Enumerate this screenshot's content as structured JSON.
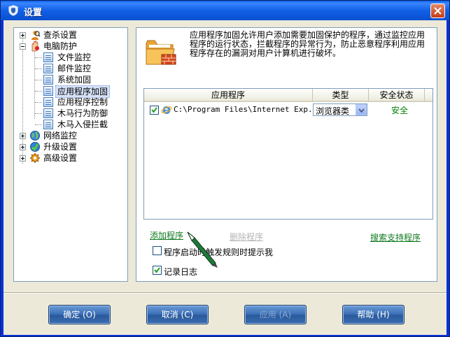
{
  "window": {
    "title": "设置"
  },
  "tree": {
    "items": [
      {
        "label": "查杀设置",
        "icon": "magnifier-user-icon",
        "expanded": false
      },
      {
        "label": "电脑防护",
        "icon": "shield-hand-icon",
        "expanded": true,
        "children": [
          {
            "label": "文件监控"
          },
          {
            "label": "邮件监控"
          },
          {
            "label": "系统加固"
          },
          {
            "label": "应用程序加固",
            "selected": true
          },
          {
            "label": "应用程序控制"
          },
          {
            "label": "木马行为防御"
          },
          {
            "label": "木马入侵拦截"
          }
        ]
      },
      {
        "label": "网络监控",
        "icon": "globe-icon",
        "expanded": false
      },
      {
        "label": "升级设置",
        "icon": "upgrade-globe-icon",
        "expanded": false
      },
      {
        "label": "高级设置",
        "icon": "gear-icon",
        "expanded": false
      }
    ]
  },
  "content": {
    "description": "应用程序加固允许用户添加需要加固保护的程序，通过监控应用程序的运行状态，拦截程序的异常行为，防止恶意程序利用应用程序存在的漏洞对用户计算机进行破坏。",
    "table": {
      "columns": [
        "应用程序",
        "类型",
        "安全状态"
      ],
      "rows": [
        {
          "checked": true,
          "path": "C:\\Program Files\\Internet Exp...",
          "type": "浏览器类",
          "status": "安全"
        }
      ]
    },
    "links": {
      "add": "添加程序",
      "delete": "删除程序",
      "search": "搜索支持程序"
    },
    "options": [
      {
        "label": "程序启动时触发规则时提示我",
        "checked": false
      },
      {
        "label": "记录日志",
        "checked": true
      }
    ]
  },
  "buttons": {
    "ok": "确定 (O)",
    "cancel": "取消 (C)",
    "apply": "应用 (A)",
    "help": "帮助 (H)"
  },
  "colors": {
    "titlebar": "#0a5fea",
    "link": "#0f7a20",
    "status_safe": "#008000",
    "button": "#3e72b8"
  }
}
